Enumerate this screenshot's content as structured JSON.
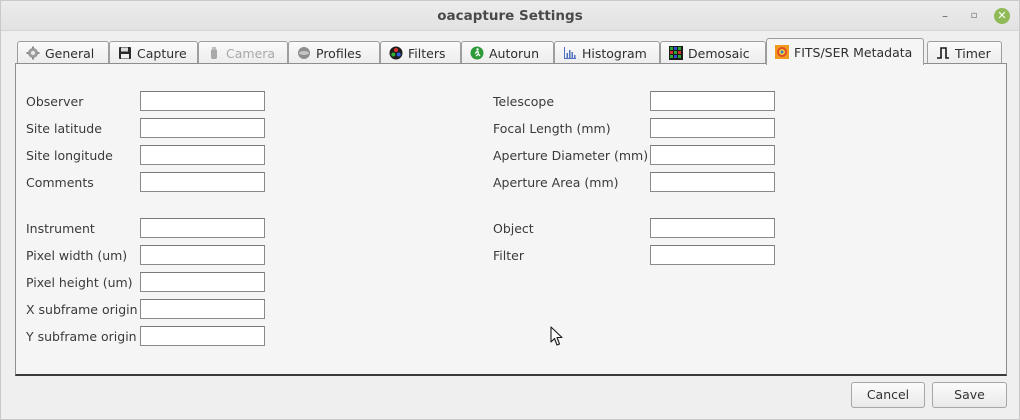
{
  "window": {
    "title": "oacapture Settings",
    "minimize_glyph": "–",
    "maximize_glyph": "▫",
    "close_glyph": "✕"
  },
  "tabs": [
    {
      "label": "General",
      "icon": "gear-icon",
      "state": "normal"
    },
    {
      "label": "Capture",
      "icon": "floppy-disk-icon",
      "state": "normal"
    },
    {
      "label": "Camera",
      "icon": "camera-icon",
      "state": "disabled"
    },
    {
      "label": "Profiles",
      "icon": "profiles-icon",
      "state": "normal"
    },
    {
      "label": "Filters",
      "icon": "filters-icon",
      "state": "normal"
    },
    {
      "label": "Autorun",
      "icon": "autorun-icon",
      "state": "normal"
    },
    {
      "label": "Histogram",
      "icon": "histogram-icon",
      "state": "normal"
    },
    {
      "label": "Demosaic",
      "icon": "demosaic-icon",
      "state": "normal"
    },
    {
      "label": "FITS/SER Metadata",
      "icon": "fits-icon",
      "state": "active"
    },
    {
      "label": "Timer",
      "icon": "timer-icon",
      "state": "normal"
    }
  ],
  "left_fields": [
    {
      "label": "Observer",
      "value": ""
    },
    {
      "label": "Site latitude",
      "value": ""
    },
    {
      "label": "Site longitude",
      "value": ""
    },
    {
      "label": "Comments",
      "value": ""
    },
    {
      "label": "Instrument",
      "value": ""
    },
    {
      "label": "Pixel width (um)",
      "value": ""
    },
    {
      "label": "Pixel height (um)",
      "value": ""
    },
    {
      "label": "X subframe origin",
      "value": ""
    },
    {
      "label": "Y subframe origin",
      "value": ""
    }
  ],
  "right_fields": [
    {
      "label": "Telescope",
      "value": ""
    },
    {
      "label": "Focal Length (mm)",
      "value": ""
    },
    {
      "label": "Aperture Diameter (mm)",
      "value": ""
    },
    {
      "label": "Aperture Area (mm)",
      "value": ""
    },
    {
      "label": "Object",
      "value": ""
    },
    {
      "label": "Filter",
      "value": ""
    }
  ],
  "buttons": {
    "cancel": "Cancel",
    "save": "Save"
  },
  "colors": {
    "window_bg": "#efefef",
    "close_button": "#8fba57"
  }
}
